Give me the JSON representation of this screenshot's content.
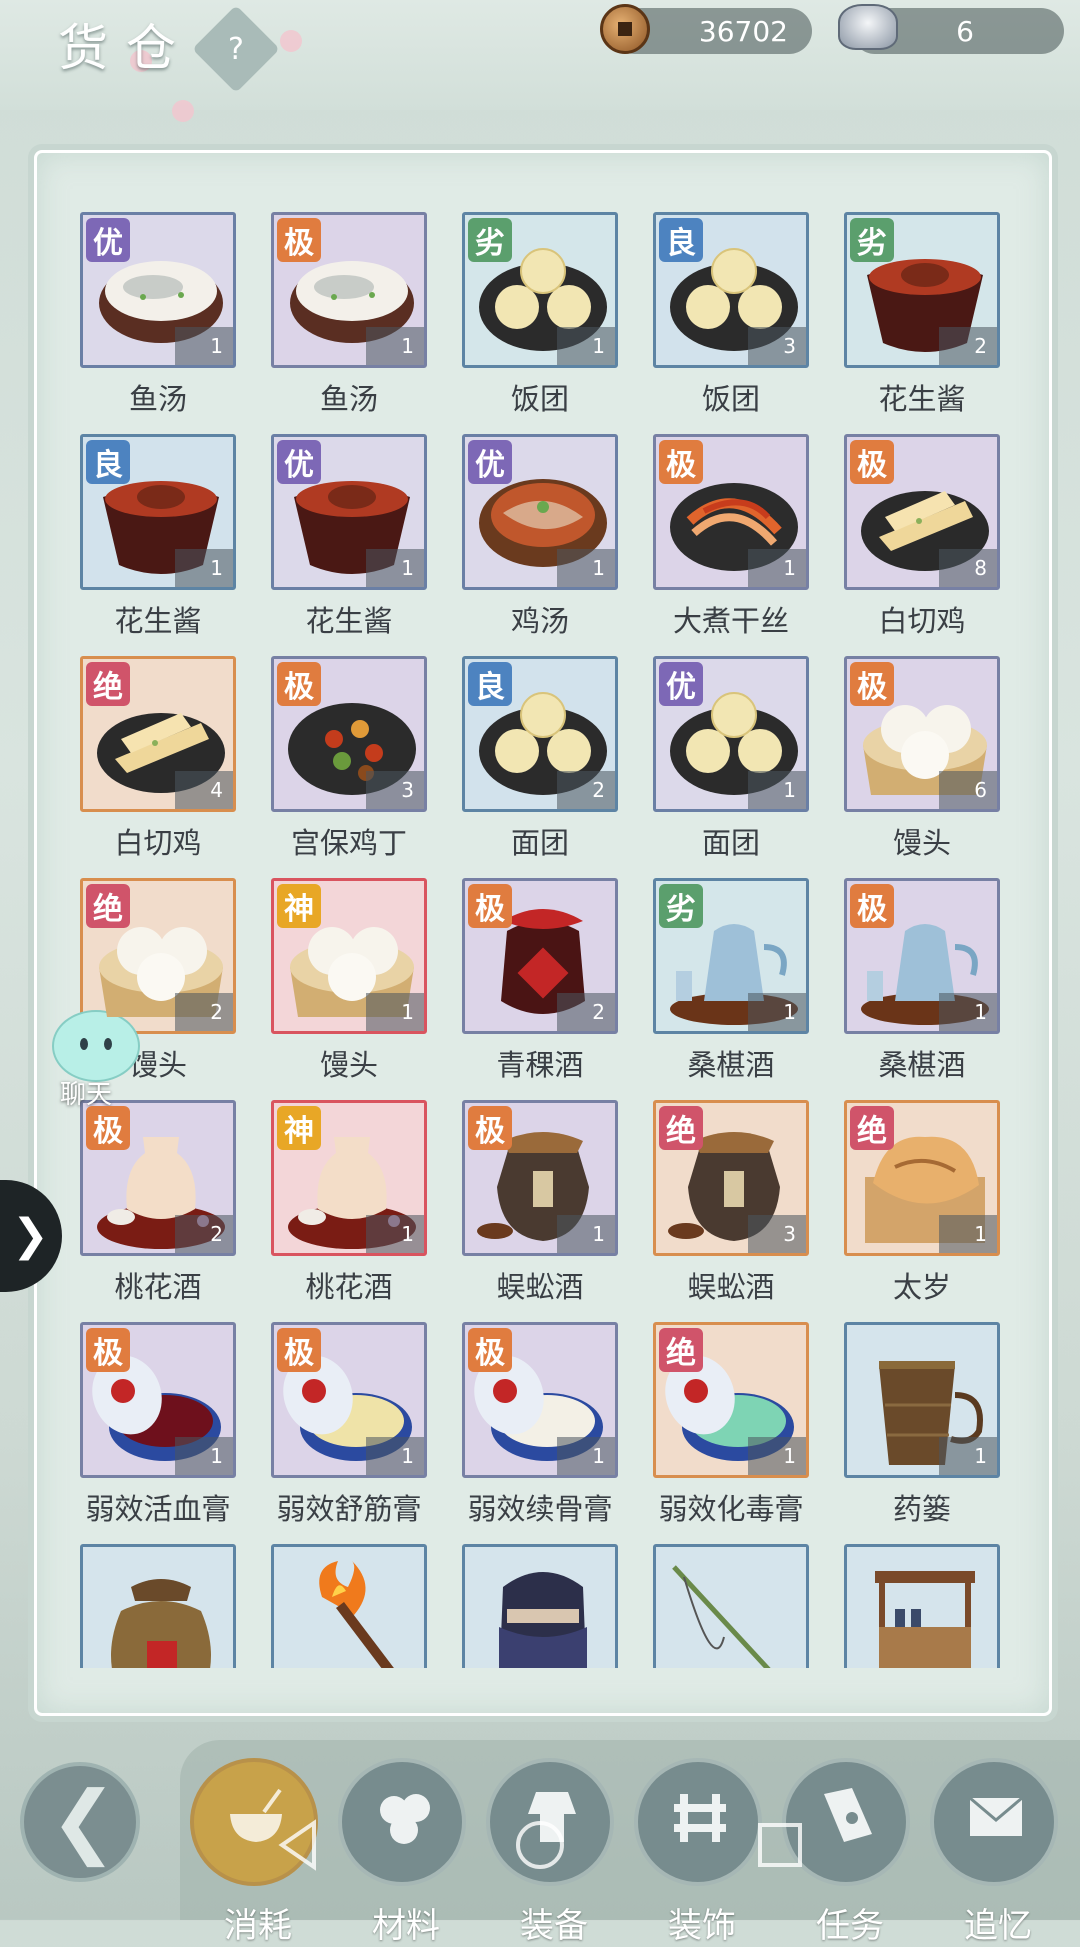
{
  "header": {
    "title": "货仓",
    "help_label": "?",
    "coins": "36702",
    "silver": "6"
  },
  "items": [
    {
      "name": "鱼汤",
      "grade": "优",
      "qty": "1",
      "art": "fish-soup"
    },
    {
      "name": "鱼汤",
      "grade": "极",
      "qty": "1",
      "art": "fish-soup"
    },
    {
      "name": "饭团",
      "grade": "劣",
      "qty": "1",
      "art": "rice-balls"
    },
    {
      "name": "饭团",
      "grade": "良",
      "qty": "3",
      "art": "rice-balls"
    },
    {
      "name": "花生酱",
      "grade": "劣",
      "qty": "2",
      "art": "peanut-sauce"
    },
    {
      "name": "花生酱",
      "grade": "良",
      "qty": "1",
      "art": "peanut-sauce"
    },
    {
      "name": "花生酱",
      "grade": "优",
      "qty": "1",
      "art": "peanut-sauce"
    },
    {
      "name": "鸡汤",
      "grade": "优",
      "qty": "1",
      "art": "chicken-soup"
    },
    {
      "name": "大煮干丝",
      "grade": "极",
      "qty": "1",
      "art": "tofu-shreds"
    },
    {
      "name": "白切鸡",
      "grade": "极",
      "qty": "8",
      "art": "white-chicken"
    },
    {
      "name": "白切鸡",
      "grade": "绝",
      "qty": "4",
      "art": "white-chicken"
    },
    {
      "name": "宫保鸡丁",
      "grade": "极",
      "qty": "3",
      "art": "kungpao"
    },
    {
      "name": "面团",
      "grade": "良",
      "qty": "2",
      "art": "rice-balls"
    },
    {
      "name": "面团",
      "grade": "优",
      "qty": "1",
      "art": "rice-balls"
    },
    {
      "name": "馒头",
      "grade": "极",
      "qty": "6",
      "art": "buns"
    },
    {
      "name": "馒头",
      "grade": "绝",
      "qty": "2",
      "art": "buns"
    },
    {
      "name": "馒头",
      "grade": "神",
      "qty": "1",
      "art": "buns"
    },
    {
      "name": "青稞酒",
      "grade": "极",
      "qty": "2",
      "art": "wine-jar"
    },
    {
      "name": "桑椹酒",
      "grade": "劣",
      "qty": "1",
      "art": "teapot"
    },
    {
      "name": "桑椹酒",
      "grade": "极",
      "qty": "1",
      "art": "teapot"
    },
    {
      "name": "桃花酒",
      "grade": "极",
      "qty": "2",
      "art": "peach-wine"
    },
    {
      "name": "桃花酒",
      "grade": "神",
      "qty": "1",
      "art": "peach-wine"
    },
    {
      "name": "蜈蚣酒",
      "grade": "极",
      "qty": "1",
      "art": "urn"
    },
    {
      "name": "蜈蚣酒",
      "grade": "绝",
      "qty": "3",
      "art": "urn"
    },
    {
      "name": "太岁",
      "grade": "绝",
      "qty": "1",
      "art": "taisui"
    },
    {
      "name": "弱效活血膏",
      "grade": "极",
      "qty": "1",
      "art": "ointment-red"
    },
    {
      "name": "弱效舒筋膏",
      "grade": "极",
      "qty": "1",
      "art": "ointment-yellow"
    },
    {
      "name": "弱效续骨膏",
      "grade": "极",
      "qty": "1",
      "art": "ointment-white"
    },
    {
      "name": "弱效化毒膏",
      "grade": "绝",
      "qty": "1",
      "art": "ointment-green"
    },
    {
      "name": "药篓",
      "grade": "",
      "qty": "1",
      "art": "basket"
    },
    {
      "name": "",
      "grade": "",
      "qty": "",
      "art": "money-bag"
    },
    {
      "name": "",
      "grade": "",
      "qty": "",
      "art": "torch"
    },
    {
      "name": "",
      "grade": "",
      "qty": "",
      "art": "mask"
    },
    {
      "name": "",
      "grade": "",
      "qty": "",
      "art": "fishing-rod"
    },
    {
      "name": "",
      "grade": "",
      "qty": "",
      "art": "stall"
    }
  ],
  "chat": {
    "label": "聊天"
  },
  "tabs": [
    {
      "label": "消耗",
      "icon": "bowl-icon",
      "active": true
    },
    {
      "label": "材料",
      "icon": "materials-icon",
      "active": false
    },
    {
      "label": "装备",
      "icon": "armor-icon",
      "active": false
    },
    {
      "label": "装饰",
      "icon": "fence-icon",
      "active": false
    },
    {
      "label": "任务",
      "icon": "book-icon",
      "active": false
    },
    {
      "label": "追忆",
      "icon": "letter-icon",
      "active": false
    }
  ],
  "colors": {
    "grade_劣": "#5b9f6d",
    "grade_良": "#4d83c0",
    "grade_优": "#7d68b6",
    "grade_极": "#e07c3f",
    "grade_绝": "#d0546a",
    "grade_神": "#e8a726"
  }
}
